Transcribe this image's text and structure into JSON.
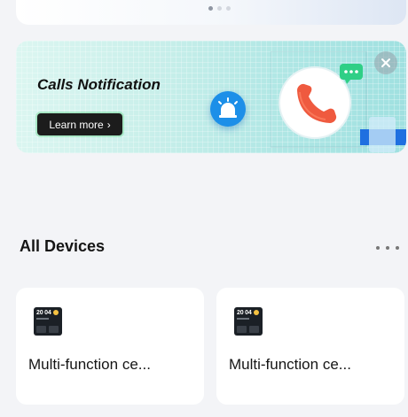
{
  "carousel": {
    "page_count": 3,
    "active_index": 0
  },
  "banner": {
    "title": "Calls Notification",
    "button_label": "Learn more",
    "button_icon": "chevron-right-icon",
    "close_icon": "close-icon",
    "art_icon": "phone-call-icon",
    "badge_icon": "alarm-light-icon",
    "accent_color": "#ef5a3f"
  },
  "devices_section": {
    "title": "All Devices",
    "more_icon": "more-horizontal-icon",
    "items": [
      {
        "name": "Multi-function ce...",
        "thumb_time": "20 04",
        "icon": "device-panel-icon"
      },
      {
        "name": "Multi-function ce...",
        "thumb_time": "20 04",
        "icon": "device-panel-icon"
      }
    ]
  }
}
